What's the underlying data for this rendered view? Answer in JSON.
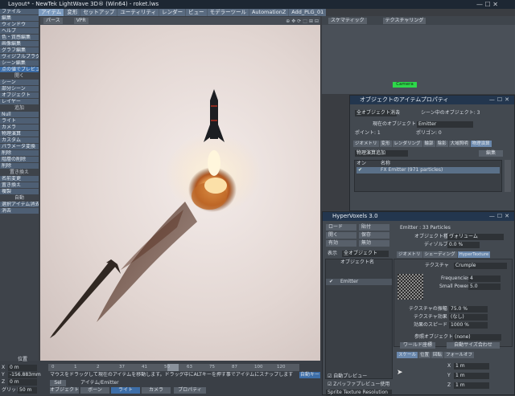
{
  "titlebar": {
    "title": "Layout* - NewTek LightWave 3D® (Win64) - roket.lws",
    "controls": "—  ☐  ✕"
  },
  "menubar": {
    "tabs": [
      "アイテム",
      "変形",
      "セットアップ",
      "ユーティリティ",
      "レンダー",
      "ビュー",
      "モデラーツール",
      "AutomationZ",
      "Add_PLG_01"
    ]
  },
  "left": {
    "top_items": [
      "ファイル",
      "編集",
      "ウィンドウ",
      "ヘルプ",
      "色・質感編集",
      "画像編集",
      "グラフ編集",
      "ヴィジブルプラグイン",
      "シーン編集"
    ],
    "highlight": "点の値でプレビュー",
    "group_open": "開く",
    "open_items": [
      "シーン",
      "部分シーン",
      "オブジェクト",
      "レイヤー"
    ],
    "group_add": "追加",
    "add_items": [
      "Null",
      "ライト",
      "カメラ",
      "物理演算",
      "カスタム",
      "パラメータ変換",
      "削除",
      "階層の削除",
      "削除"
    ],
    "group_replace": "置き換え",
    "replace_items": [
      "名前変更",
      "置き換え",
      "複製"
    ],
    "group_other": "自動",
    "other_items": [
      "選択アイテム消去",
      "消去"
    ],
    "pos_label": "位置"
  },
  "viewport": {
    "view_mode": "パース",
    "render_mode": "VPR"
  },
  "rightvp": {
    "view": "スケマティック",
    "display": "テクスチャリング",
    "camera_label": "Camera"
  },
  "props": {
    "title": "オブジェクトのアイテムプロパティ",
    "clear_btn": "全オブジェクト消去",
    "scene_count": "シーン中のオブジェクト: 3",
    "current_label": "現在のオブジェクト",
    "current_value": "Emitter",
    "points": "ポイント: 1",
    "polys": "ポリゴン: 0",
    "tabs": [
      "ジオメトリ",
      "変形",
      "レンダリング",
      "輪郭",
      "陰影",
      "大域照明",
      "物理演算"
    ],
    "add_dd": "物理演算追加",
    "edit_btn": "編集",
    "col_on": "オン",
    "col_name": "名称",
    "row_name": "FX Emitter (971 particles)"
  },
  "hyper": {
    "title": "HyperVoxels 3.0",
    "btns_left": [
      "ロード",
      "開く",
      "有効",
      "表示"
    ],
    "btns_right": [
      "貼付",
      "保存",
      "無効"
    ],
    "show_dd": "全オブジェクト",
    "list_header": "オブジェクト名",
    "list_item": "Emitter",
    "info": "Emitter : 33 Particles",
    "obj_type_label": "オブジェクト種",
    "obj_type": "ヴォリューム",
    "dither_label": "ディゾルブ",
    "dither_val": "0.0 %",
    "tabs": [
      "ジオメトリ",
      "シェーディング",
      "HyperTexture"
    ],
    "texture_label": "テクスチャ",
    "texture_val": "Crumple",
    "freq_label": "Frequencies",
    "freq_val": "4",
    "small_label": "Small Power",
    "small_val": "5.0",
    "amp_label": "テクスチャの振幅",
    "amp_val": "75.0 %",
    "effect_label": "テクスチャ効果",
    "effect_val": "(なし)",
    "speed_label": "効果のスピード",
    "speed_val": "1000 %",
    "ref_label": "参照オブジェクト",
    "ref_val": "(none)",
    "world_btn": "ワールド座標",
    "auto_btn": "自動サイズ合わせ",
    "subtabs": [
      "スケール",
      "位置",
      "回転",
      "フォールオフ"
    ],
    "x": "1 m",
    "y": "1 m",
    "z": "1 m",
    "chk1": "自動プレビュー",
    "chk2": "Zバッファプレビュー使用",
    "sprite": "Sprite Texture Resolution"
  },
  "status": {
    "x": "0 m",
    "y": "-156.883mm",
    "z": "0 m",
    "grid": "50 m",
    "message": "マウスをドラッグして現在のアイテムを移動します。ドラッグ中にALTキーを押す事でアイテムにスナップします",
    "obj_btn": "オブジェクト",
    "bone_btn": "ボーン",
    "light_btn": "ライト",
    "cam_btn": "カメラ",
    "item_btn": "アイテム/Emitter",
    "prop_label": "プロパティ",
    "sel_btn": "Sel",
    "auto_key": "自動キー",
    "frames": [
      "0",
      "1",
      "2",
      "37",
      "41",
      "50",
      "63",
      "75",
      "87",
      "100",
      "120"
    ]
  }
}
